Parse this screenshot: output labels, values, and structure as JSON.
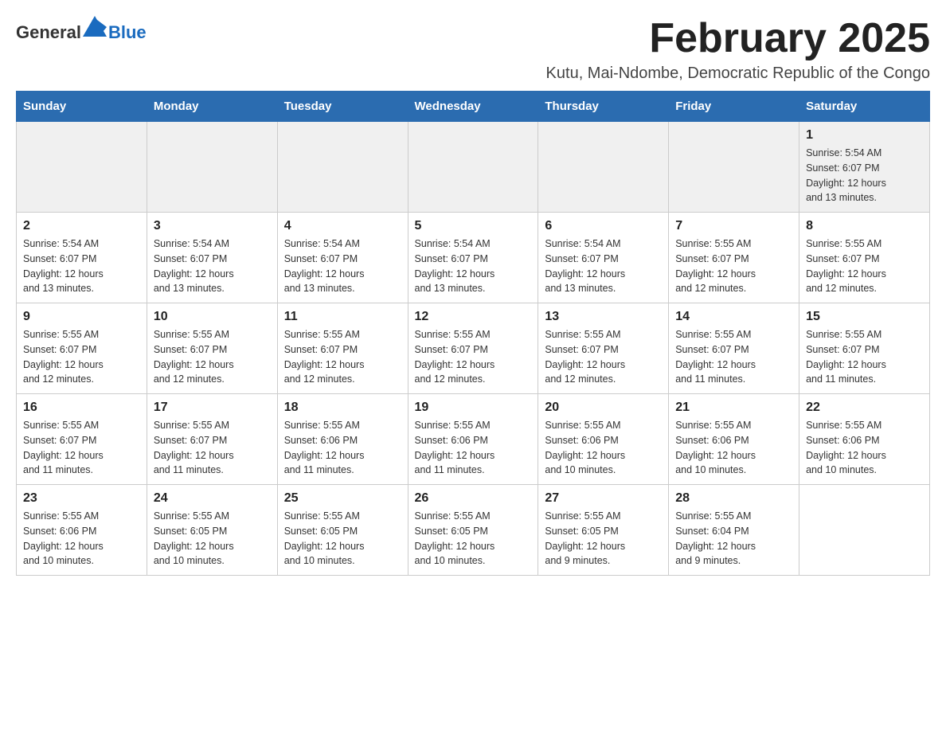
{
  "logo": {
    "general": "General",
    "blue": "Blue"
  },
  "header": {
    "month_title": "February 2025",
    "subtitle": "Kutu, Mai-Ndombe, Democratic Republic of the Congo"
  },
  "days_of_week": [
    "Sunday",
    "Monday",
    "Tuesday",
    "Wednesday",
    "Thursday",
    "Friday",
    "Saturday"
  ],
  "weeks": [
    [
      {
        "day": "",
        "info": ""
      },
      {
        "day": "",
        "info": ""
      },
      {
        "day": "",
        "info": ""
      },
      {
        "day": "",
        "info": ""
      },
      {
        "day": "",
        "info": ""
      },
      {
        "day": "",
        "info": ""
      },
      {
        "day": "1",
        "info": "Sunrise: 5:54 AM\nSunset: 6:07 PM\nDaylight: 12 hours\nand 13 minutes."
      }
    ],
    [
      {
        "day": "2",
        "info": "Sunrise: 5:54 AM\nSunset: 6:07 PM\nDaylight: 12 hours\nand 13 minutes."
      },
      {
        "day": "3",
        "info": "Sunrise: 5:54 AM\nSunset: 6:07 PM\nDaylight: 12 hours\nand 13 minutes."
      },
      {
        "day": "4",
        "info": "Sunrise: 5:54 AM\nSunset: 6:07 PM\nDaylight: 12 hours\nand 13 minutes."
      },
      {
        "day": "5",
        "info": "Sunrise: 5:54 AM\nSunset: 6:07 PM\nDaylight: 12 hours\nand 13 minutes."
      },
      {
        "day": "6",
        "info": "Sunrise: 5:54 AM\nSunset: 6:07 PM\nDaylight: 12 hours\nand 13 minutes."
      },
      {
        "day": "7",
        "info": "Sunrise: 5:55 AM\nSunset: 6:07 PM\nDaylight: 12 hours\nand 12 minutes."
      },
      {
        "day": "8",
        "info": "Sunrise: 5:55 AM\nSunset: 6:07 PM\nDaylight: 12 hours\nand 12 minutes."
      }
    ],
    [
      {
        "day": "9",
        "info": "Sunrise: 5:55 AM\nSunset: 6:07 PM\nDaylight: 12 hours\nand 12 minutes."
      },
      {
        "day": "10",
        "info": "Sunrise: 5:55 AM\nSunset: 6:07 PM\nDaylight: 12 hours\nand 12 minutes."
      },
      {
        "day": "11",
        "info": "Sunrise: 5:55 AM\nSunset: 6:07 PM\nDaylight: 12 hours\nand 12 minutes."
      },
      {
        "day": "12",
        "info": "Sunrise: 5:55 AM\nSunset: 6:07 PM\nDaylight: 12 hours\nand 12 minutes."
      },
      {
        "day": "13",
        "info": "Sunrise: 5:55 AM\nSunset: 6:07 PM\nDaylight: 12 hours\nand 12 minutes."
      },
      {
        "day": "14",
        "info": "Sunrise: 5:55 AM\nSunset: 6:07 PM\nDaylight: 12 hours\nand 11 minutes."
      },
      {
        "day": "15",
        "info": "Sunrise: 5:55 AM\nSunset: 6:07 PM\nDaylight: 12 hours\nand 11 minutes."
      }
    ],
    [
      {
        "day": "16",
        "info": "Sunrise: 5:55 AM\nSunset: 6:07 PM\nDaylight: 12 hours\nand 11 minutes."
      },
      {
        "day": "17",
        "info": "Sunrise: 5:55 AM\nSunset: 6:07 PM\nDaylight: 12 hours\nand 11 minutes."
      },
      {
        "day": "18",
        "info": "Sunrise: 5:55 AM\nSunset: 6:06 PM\nDaylight: 12 hours\nand 11 minutes."
      },
      {
        "day": "19",
        "info": "Sunrise: 5:55 AM\nSunset: 6:06 PM\nDaylight: 12 hours\nand 11 minutes."
      },
      {
        "day": "20",
        "info": "Sunrise: 5:55 AM\nSunset: 6:06 PM\nDaylight: 12 hours\nand 10 minutes."
      },
      {
        "day": "21",
        "info": "Sunrise: 5:55 AM\nSunset: 6:06 PM\nDaylight: 12 hours\nand 10 minutes."
      },
      {
        "day": "22",
        "info": "Sunrise: 5:55 AM\nSunset: 6:06 PM\nDaylight: 12 hours\nand 10 minutes."
      }
    ],
    [
      {
        "day": "23",
        "info": "Sunrise: 5:55 AM\nSunset: 6:06 PM\nDaylight: 12 hours\nand 10 minutes."
      },
      {
        "day": "24",
        "info": "Sunrise: 5:55 AM\nSunset: 6:05 PM\nDaylight: 12 hours\nand 10 minutes."
      },
      {
        "day": "25",
        "info": "Sunrise: 5:55 AM\nSunset: 6:05 PM\nDaylight: 12 hours\nand 10 minutes."
      },
      {
        "day": "26",
        "info": "Sunrise: 5:55 AM\nSunset: 6:05 PM\nDaylight: 12 hours\nand 10 minutes."
      },
      {
        "day": "27",
        "info": "Sunrise: 5:55 AM\nSunset: 6:05 PM\nDaylight: 12 hours\nand 9 minutes."
      },
      {
        "day": "28",
        "info": "Sunrise: 5:55 AM\nSunset: 6:04 PM\nDaylight: 12 hours\nand 9 minutes."
      },
      {
        "day": "",
        "info": ""
      }
    ]
  ]
}
